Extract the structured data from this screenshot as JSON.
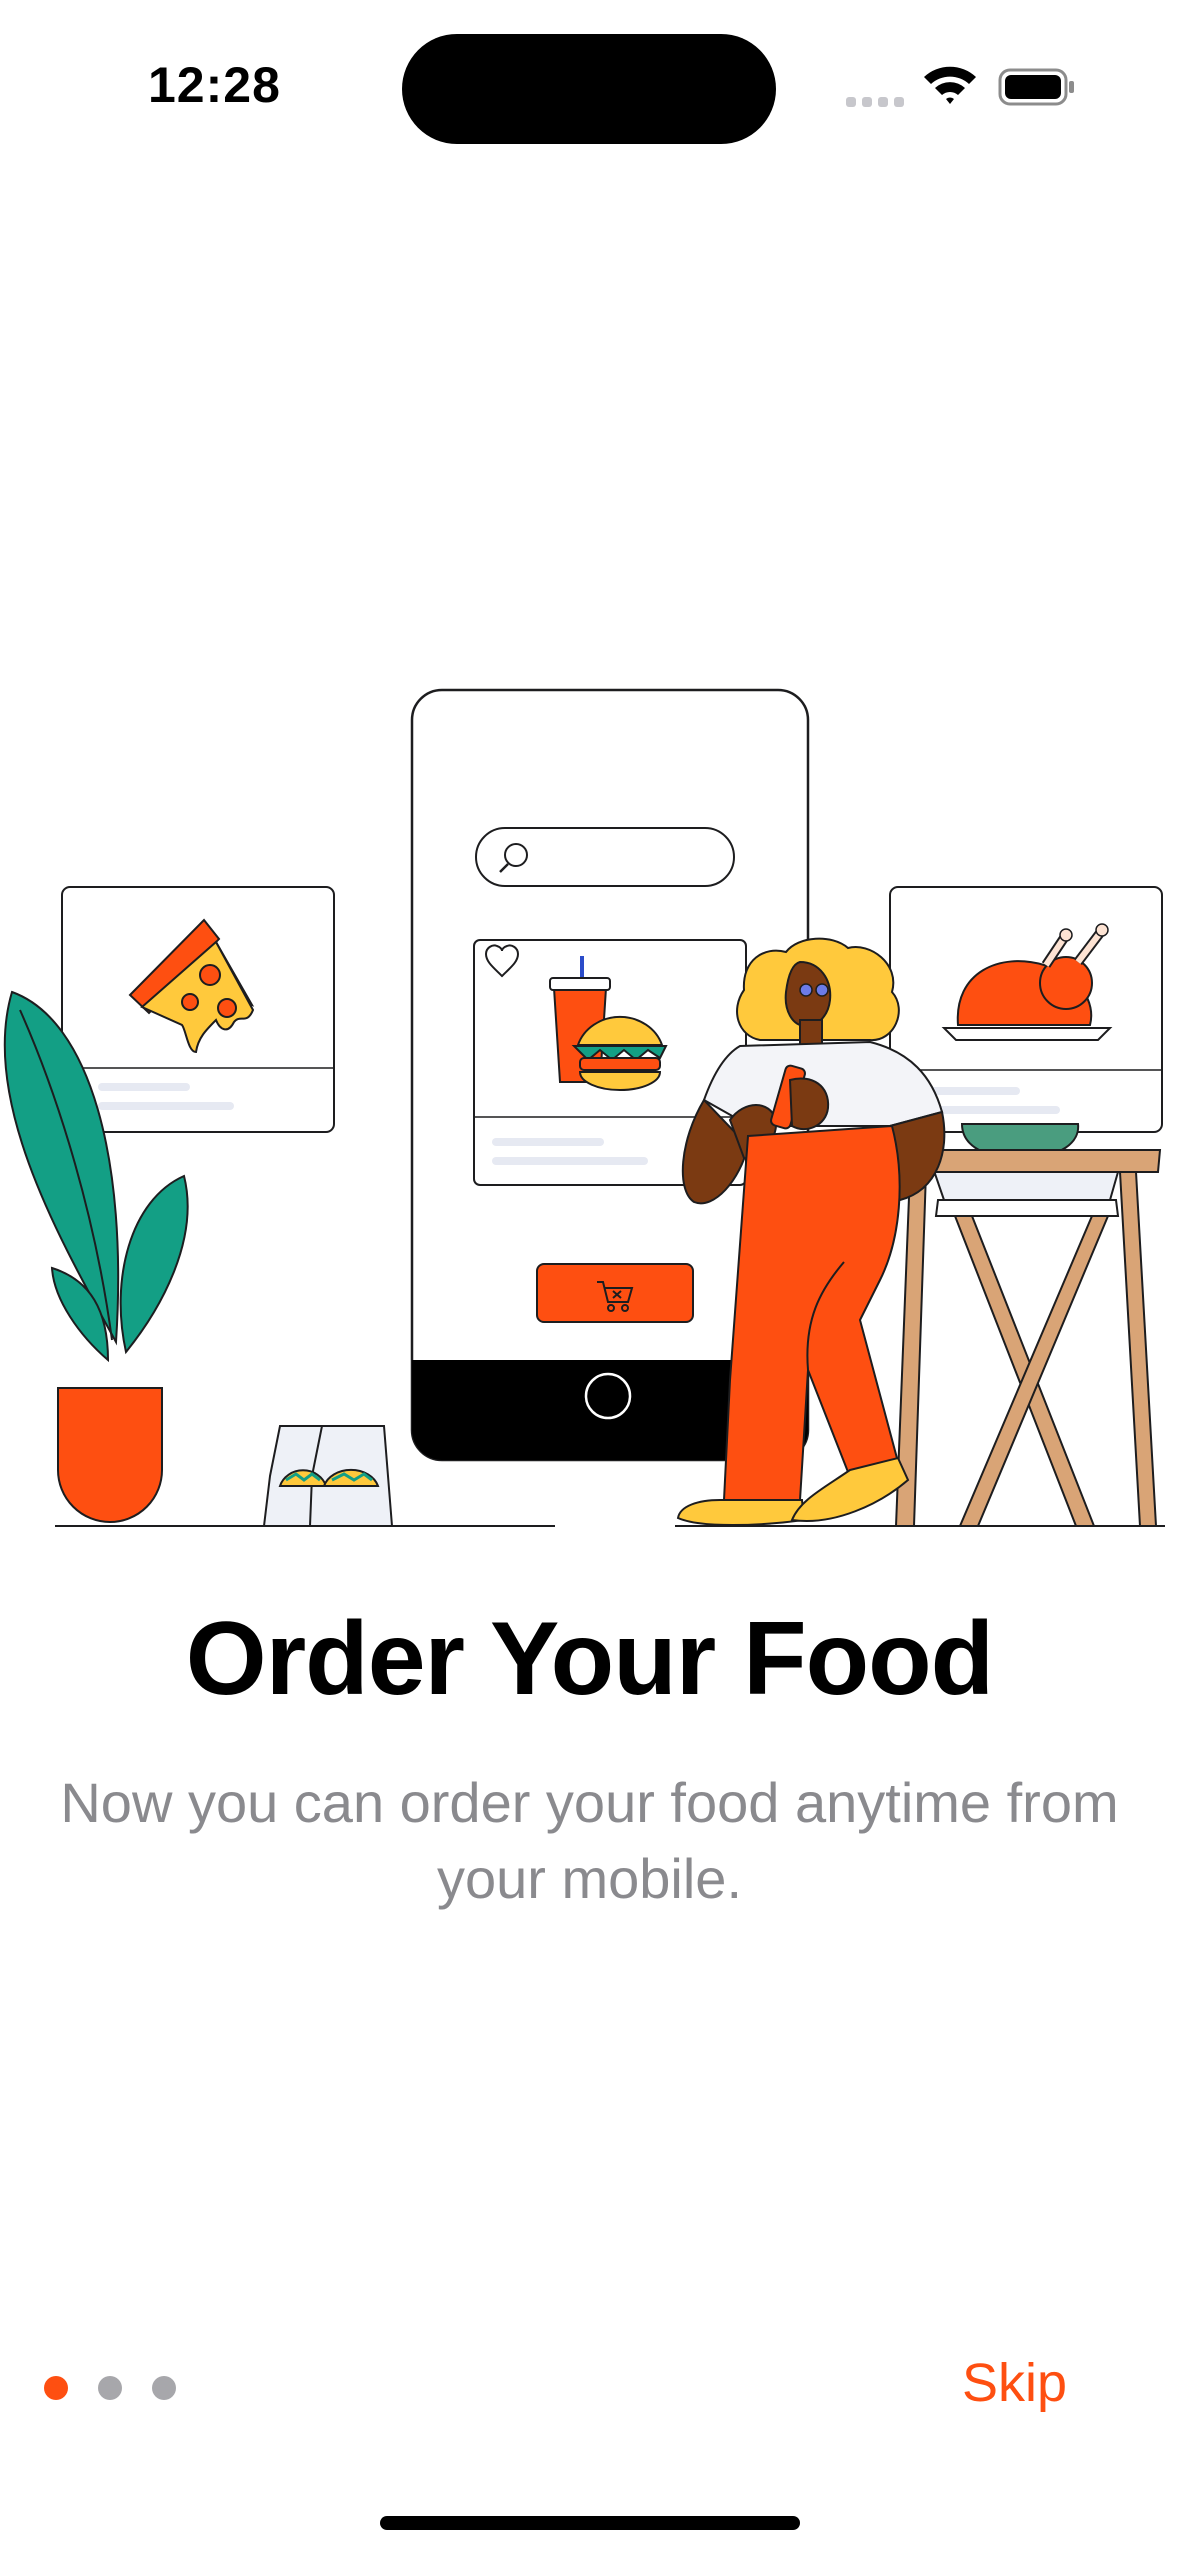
{
  "status_bar": {
    "time": "12:28",
    "icons": [
      "cellular-signal-icon",
      "wifi-icon",
      "battery-icon"
    ]
  },
  "illustration": {
    "icons": [
      "phone-illustration",
      "search-icon",
      "heart-icon",
      "burger-icon",
      "drink-icon",
      "cart-icon",
      "pizza-icon",
      "roast-chicken-icon",
      "taco-bag-icon",
      "plant-icon",
      "person-with-phone",
      "table-icon"
    ]
  },
  "onboarding": {
    "title": "Order Your Food",
    "subtitle": "Now you can order your food anytime from your mobile."
  },
  "pager": {
    "total": 3,
    "current": 1
  },
  "footer": {
    "skip_label": "Skip"
  },
  "colors": {
    "accent": "#FE4F11",
    "text_secondary": "#8A8A8E",
    "dot_inactive": "#A7A7AB",
    "plant_green": "#139F85",
    "yellow": "#FFC93C"
  }
}
